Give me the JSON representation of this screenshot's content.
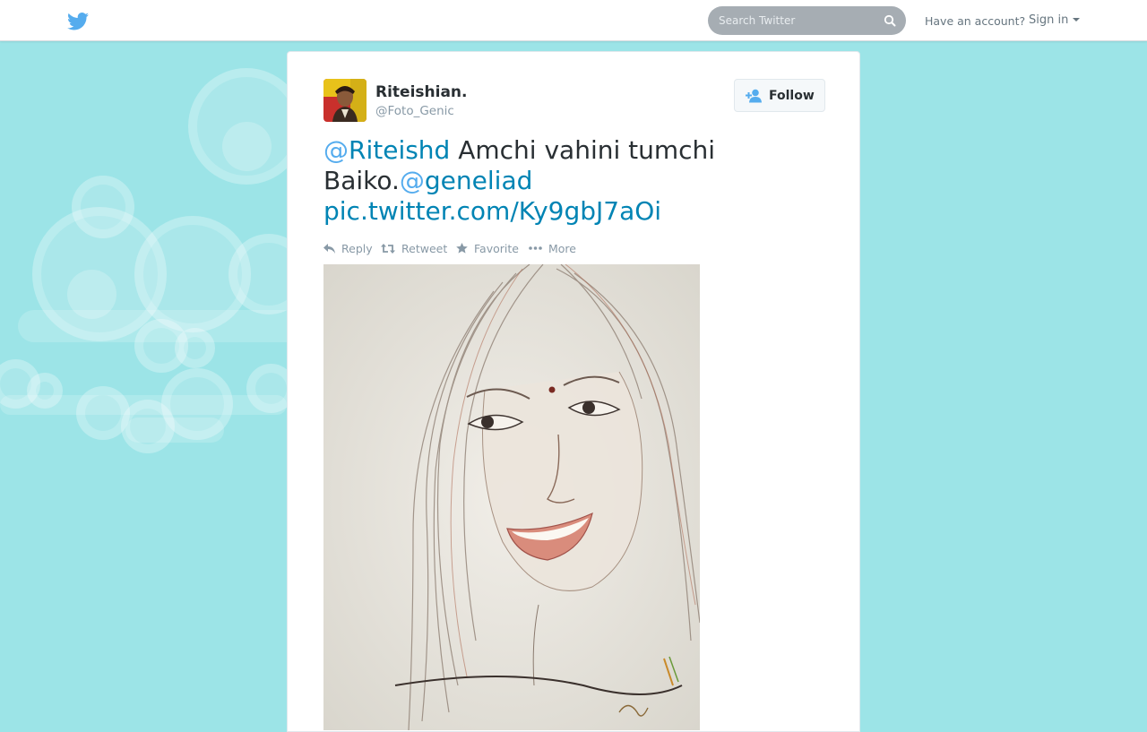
{
  "topbar": {
    "search": {
      "placeholder": "Search Twitter",
      "value": ""
    },
    "have_account": "Have an account?",
    "sign_in": "Sign in"
  },
  "tweet": {
    "fullname": "Riteishian.",
    "username": "@Foto_Genic",
    "follow_label": "Follow",
    "text": {
      "mention1_at": "@",
      "mention1_name": "Riteishd",
      "middle": " Amchi vahini tumchi Baiko.",
      "mention2_at": "@",
      "mention2_name": "geneliad",
      "link": "pic.twitter.com/Ky9gbJ7aOi"
    },
    "actions": {
      "reply": "Reply",
      "retweet": "Retweet",
      "favorite": "Favorite",
      "more": "More"
    },
    "media_description": "pencil-sketch-portrait"
  },
  "colors": {
    "background": "#9ce4e7",
    "link": "#0084b4",
    "mention_at": "#55acee",
    "twitter_blue": "#55acee",
    "text": "#292f33",
    "muted": "#8899a6"
  },
  "icons": [
    "twitter-bird-icon",
    "search-icon",
    "caret-down-icon",
    "follow-user-icon",
    "reply-icon",
    "retweet-icon",
    "star-icon",
    "more-dots-icon"
  ]
}
